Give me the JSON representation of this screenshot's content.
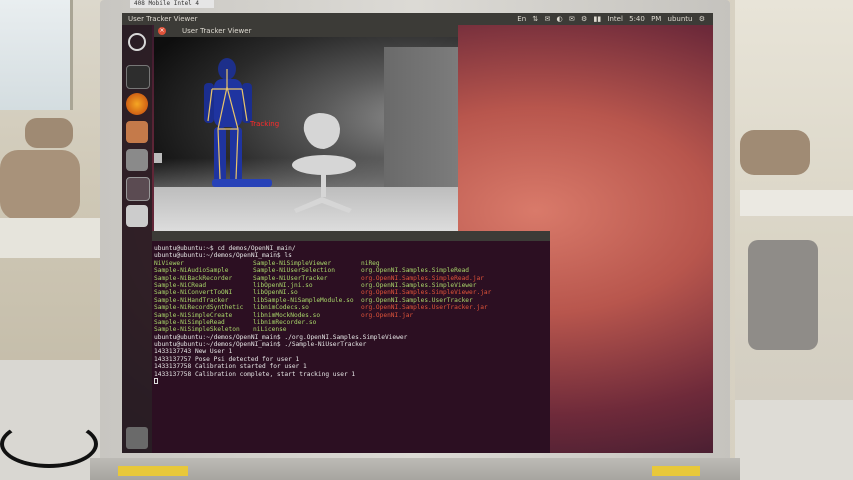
{
  "bezel_label": "408 Mobile Intel 4",
  "desktop": {
    "panel_title": "User Tracker Viewer",
    "tray_text": "En  ⇅  ✉  ◐  ✉  ⚙  ▮▮  Intel 5:40 PM  ubuntu ⚙"
  },
  "launcher": {
    "icons": [
      "ubuntu-dash-icon",
      "terminal-icon",
      "firefox-icon",
      "files-icon",
      "settings-icon",
      "workspace-icon",
      "drive-icon",
      "trash-icon"
    ]
  },
  "viewer": {
    "title": "User Tracker Viewer",
    "tracking_label": "Tracking"
  },
  "terminal": {
    "prompt_lines": [
      "ubuntu@ubuntu:~$ cd demos/OpenNI_main/",
      "ubuntu@ubuntu:~/demos/OpenNI_main$ ls"
    ],
    "listing": [
      [
        {
          "t": "NiViewer",
          "c": "g"
        },
        {
          "t": "Sample-NiSimpleViewer",
          "c": "g"
        },
        {
          "t": "niReg",
          "c": "g"
        }
      ],
      [
        {
          "t": "Sample-NiAudioSample",
          "c": "g"
        },
        {
          "t": "Sample-NiUserSelection",
          "c": "g"
        },
        {
          "t": "org.OpenNI.Samples.SimpleRead",
          "c": "g"
        }
      ],
      [
        {
          "t": "Sample-NiBackRecorder",
          "c": "g"
        },
        {
          "t": "Sample-NiUserTracker",
          "c": "g"
        },
        {
          "t": "org.OpenNI.Samples.SimpleRead.jar",
          "c": "r"
        }
      ],
      [
        {
          "t": "Sample-NiCRead",
          "c": "g"
        },
        {
          "t": "libOpenNI.jni.so",
          "c": "g"
        },
        {
          "t": "org.OpenNI.Samples.SimpleViewer",
          "c": "g"
        }
      ],
      [
        {
          "t": "Sample-NiConvertToONI",
          "c": "g"
        },
        {
          "t": "libOpenNI.so",
          "c": "g"
        },
        {
          "t": "org.OpenNI.Samples.SimpleViewer.jar",
          "c": "r"
        }
      ],
      [
        {
          "t": "Sample-NiHandTracker",
          "c": "g"
        },
        {
          "t": "libSample-NiSampleModule.so",
          "c": "g"
        },
        {
          "t": "org.OpenNI.Samples.UserTracker",
          "c": "g"
        }
      ],
      [
        {
          "t": "Sample-NiRecordSynthetic",
          "c": "g"
        },
        {
          "t": "libnimCodecs.so",
          "c": "g"
        },
        {
          "t": "org.OpenNI.Samples.UserTracker.jar",
          "c": "r"
        }
      ],
      [
        {
          "t": "Sample-NiSimpleCreate",
          "c": "g"
        },
        {
          "t": "libnimMockNodes.so",
          "c": "g"
        },
        {
          "t": "org.OpenNI.jar",
          "c": "r"
        }
      ],
      [
        {
          "t": "Sample-NiSimpleRead",
          "c": "g"
        },
        {
          "t": "libnimRecorder.so",
          "c": "g"
        },
        {
          "t": "",
          "c": "g"
        }
      ],
      [
        {
          "t": "Sample-NiSimpleSkeleton",
          "c": "g"
        },
        {
          "t": "niLicense",
          "c": "g"
        },
        {
          "t": "",
          "c": "g"
        }
      ]
    ],
    "after_lines": [
      "ubuntu@ubuntu:~/demos/OpenNI_main$ ./org.OpenNI.Samples.SimpleViewer",
      "ubuntu@ubuntu:~/demos/OpenNI_main$ ./Sample-NiUserTracker",
      "1433137743 New User 1",
      "1433137757 Pose Psi detected for user 1",
      "1433137758 Calibration started for user 1",
      "1433137758 Calibration complete, start tracking user 1"
    ]
  },
  "colors": {
    "ls_green": "#a9d66a",
    "ls_red": "#e0533a",
    "terminal_bg": "#2c0f22"
  }
}
